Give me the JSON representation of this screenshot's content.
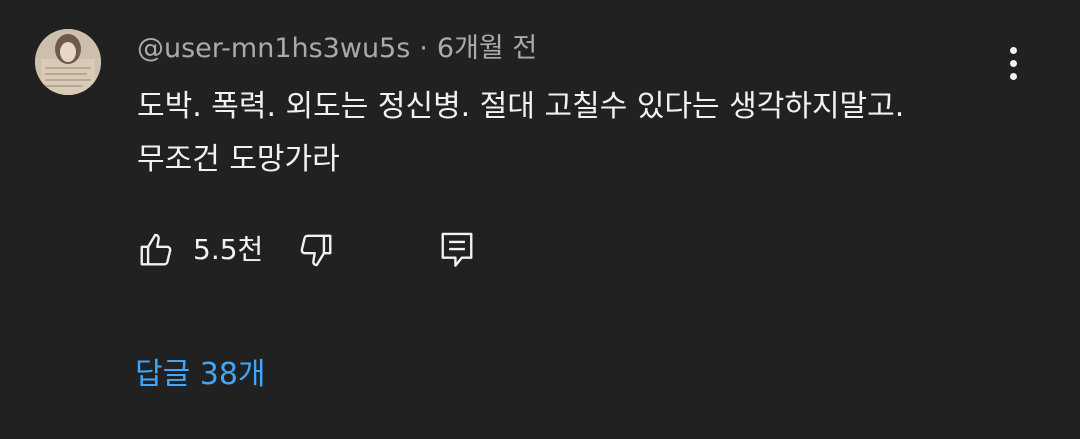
{
  "comment": {
    "author": "@user-mn1hs3wu5s",
    "separator": "·",
    "time": "6개월 전",
    "text_line1": "도박. 폭력. 외도는 정신병. 절대 고칠수 있다는 생각하지말고.",
    "text_line2": "무조건 도망가라",
    "likes": "5.5천",
    "replies_label": "답글 38개"
  },
  "icons": {
    "avatar": "avatar-image",
    "more": "more-vert-icon",
    "like": "thumbs-up-icon",
    "dislike": "thumbs-down-icon",
    "reply": "comment-reply-icon"
  },
  "colors": {
    "background": "#212121",
    "text_primary": "#f1f1f1",
    "text_secondary": "#aaaaaa",
    "link": "#3ea6ff"
  }
}
